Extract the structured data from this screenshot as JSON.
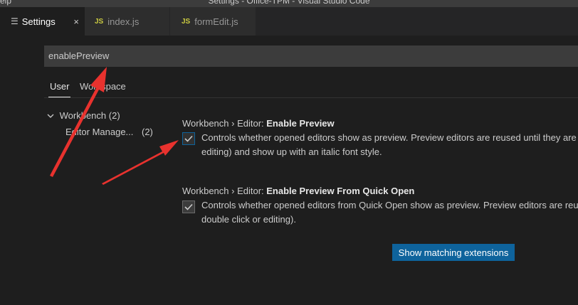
{
  "window": {
    "menu_partial": "elp",
    "title": "Settings - Office-TPM - Visual Studio Code"
  },
  "tabs": [
    {
      "label": "Settings",
      "icon": "settings-lines-icon",
      "close": "×"
    },
    {
      "label": "index.js",
      "icon_text": "JS"
    },
    {
      "label": "formEdit.js",
      "icon_text": "JS"
    }
  ],
  "search": {
    "value": "enablePreview"
  },
  "scopes": {
    "user": "User",
    "workspace": "Workspace"
  },
  "toc": {
    "workbench": "Workbench",
    "workbench_count": "(2)",
    "editor_management": "Editor Manage...",
    "editor_management_count": "(2)"
  },
  "settings": [
    {
      "category": "Workbench › Editor:",
      "name": "Enable Preview",
      "checked": true,
      "description_line1": "Controls whether opened editors show as preview. Preview editors are reused until they are p",
      "description_line2": "editing) and show up with an italic font style."
    },
    {
      "category": "Workbench › Editor:",
      "name": "Enable Preview From Quick Open",
      "checked": true,
      "description_line1": "Controls whether opened editors from Quick Open show as preview. Preview editors are reus",
      "description_line2": "double click or editing)."
    }
  ],
  "actions": {
    "show_extensions": "Show matching extensions"
  },
  "colors": {
    "accent": "#0e639c",
    "annotation_arrow": "#e8322e",
    "js_icon": "#cbcb41"
  }
}
